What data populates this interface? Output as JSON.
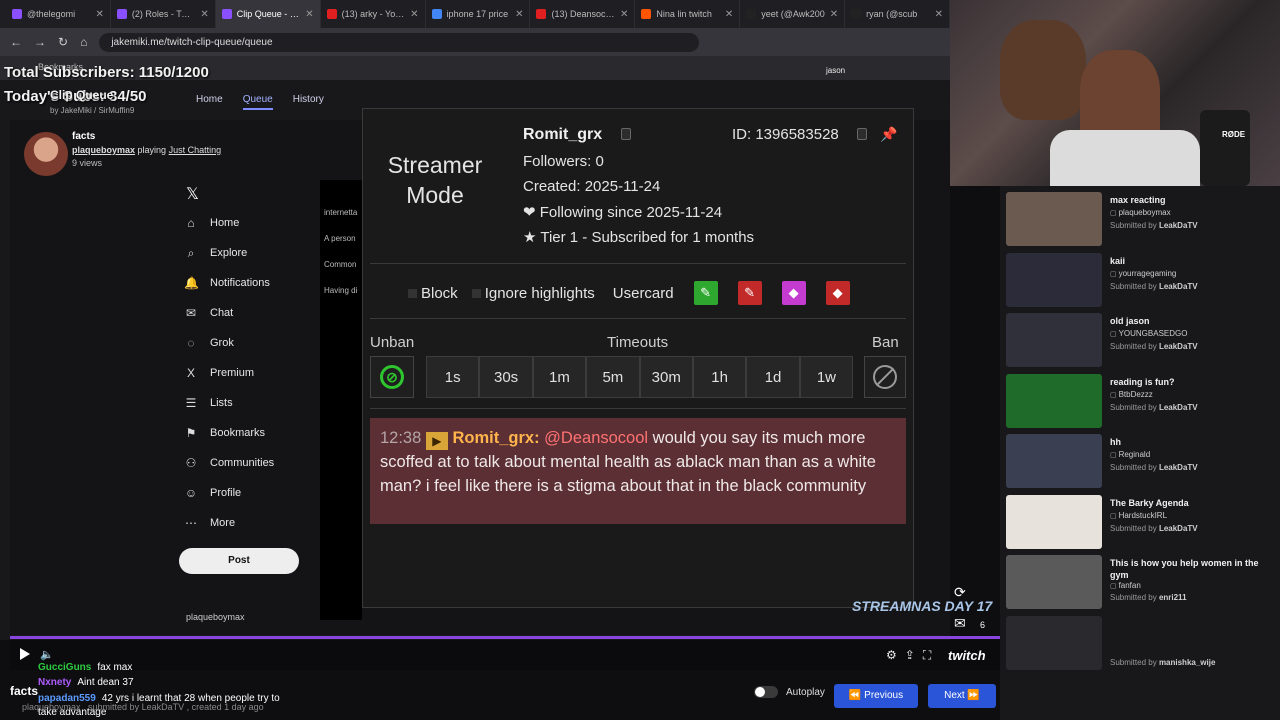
{
  "tabs": [
    {
      "label": "@thelegomi",
      "color": "#8a4fff"
    },
    {
      "label": "(2) Roles - Twitch",
      "color": "#8a4fff"
    },
    {
      "label": "Clip Queue - Cli",
      "color": "#8a4fff",
      "active": true
    },
    {
      "label": "(13) arky - YouTube",
      "color": "#e02020"
    },
    {
      "label": "iphone 17 price",
      "color": "#4285f4"
    },
    {
      "label": "(13) Deansocool",
      "color": "#e02020"
    },
    {
      "label": "Nina lin twitch",
      "color": "#ff5500"
    },
    {
      "label": "yeet (@Awk200",
      "color": "#222222"
    },
    {
      "label": "ryan (@scub",
      "color": "#222222"
    }
  ],
  "url": "jakemiki.me/twitch-clip-queue/queue",
  "bookmarks_label": "Bookmarks",
  "overlay": {
    "total_subs": "Total Subscribers: 1150/1200",
    "today_subs": "Today's Subs: 34/50",
    "cam_name": "jason"
  },
  "clip_nav": {
    "app_title": "Clip Queue",
    "by_line": "by JakeMiki / SirMuffin9",
    "links": [
      "Home",
      "Queue",
      "History"
    ]
  },
  "current_clip": {
    "title": "facts",
    "channel": "plaqueboymax",
    "playing_label": "playing",
    "game": "Just Chatting",
    "views": "9 views"
  },
  "x_sidebar": {
    "items": [
      {
        "label": "Home",
        "icon": "⌂"
      },
      {
        "label": "Explore",
        "icon": "⌕"
      },
      {
        "label": "Notifications",
        "icon": "🔔"
      },
      {
        "label": "Chat",
        "icon": "✉"
      },
      {
        "label": "Grok",
        "icon": "◌"
      },
      {
        "label": "Premium",
        "icon": "X"
      },
      {
        "label": "Lists",
        "icon": "☰"
      },
      {
        "label": "Bookmarks",
        "icon": "⚑"
      },
      {
        "label": "Communities",
        "icon": "⚇"
      },
      {
        "label": "Profile",
        "icon": "☺"
      },
      {
        "label": "More",
        "icon": "⋯"
      }
    ],
    "post": "Post",
    "profile_name": "plaqueboymax",
    "snippets": [
      "internetta",
      "A person",
      "Common",
      "Having di"
    ]
  },
  "usercard": {
    "mode": "Streamer Mode",
    "username": "Romit_grx",
    "id": "ID: 1396583528",
    "followers": "Followers: 0",
    "created": "Created: 2025-11-24",
    "following": "❤ Following since 2025-11-24",
    "tier": "★ Tier 1 - Subscribed for 1 months",
    "block": "Block",
    "ignore": "Ignore highlights",
    "usercard_label": "Usercard",
    "unban": "Unban",
    "timeouts_label": "Timeouts",
    "ban": "Ban",
    "timeouts": [
      "1s",
      "30s",
      "1m",
      "5m",
      "30m",
      "1h",
      "1d",
      "1w"
    ],
    "mod_buttons": [
      {
        "name": "mod-green-button",
        "color": "#2fa82f",
        "glyph": "✎"
      },
      {
        "name": "mod-red-button",
        "color": "#c22a2a",
        "glyph": "✎"
      },
      {
        "name": "vip-gem-button",
        "color": "#c43bd0",
        "glyph": "◆"
      },
      {
        "name": "vip-red-gem-button",
        "color": "#c22a2a",
        "glyph": "◆"
      }
    ],
    "message": {
      "time": "12:38",
      "author": "Romit_grx:",
      "mention": "@Deansocool",
      "text": "would you say its much more scoffed at to talk about mental health as ablack man than as a white man? i feel like there is a stigma about that in the black community"
    }
  },
  "chat_overlay": [
    {
      "user": "GucciGuns",
      "color": "#2ecc40",
      "text": "fax max"
    },
    {
      "user": "Nxnety",
      "color": "#b05cff",
      "text": "Aint dean 37"
    },
    {
      "user": "papadan559",
      "color": "#5b9bff",
      "text": "42 yrs i learnt that 28 when people try to take advantage"
    }
  ],
  "footer": {
    "clip_title": "facts",
    "submitted": "plaqueboymax , submitted by LeakDaTV , created 1 day ago",
    "autoplay": "Autoplay",
    "previous": "Previous",
    "next": "Next",
    "mail_count": "6",
    "streamnas": "STREAMNAS DAY 17"
  },
  "queue": [
    {
      "title": "max reacting",
      "channel": "plaqueboymax",
      "submitter": "LeakDaTV",
      "thumb": "#6a5a50"
    },
    {
      "title": "kaii",
      "channel": "yourragegaming",
      "submitter": "LeakDaTV",
      "thumb": "#2b2b3a"
    },
    {
      "title": "old jason",
      "channel": "YOUNGBASEDGO",
      "submitter": "LeakDaTV",
      "thumb": "#30303a"
    },
    {
      "title": "reading is fun?",
      "channel": "BtbDezzz",
      "submitter": "LeakDaTV",
      "thumb": "#1f6b2a"
    },
    {
      "title": "hh",
      "channel": "Reginald",
      "submitter": "LeakDaTV",
      "thumb": "#3b3f52"
    },
    {
      "title": "The Barky Agenda",
      "channel": "HardstuckIRL",
      "submitter": "LeakDaTV",
      "thumb": "#e8e2dc"
    },
    {
      "title": "This is how you help women in the gym",
      "channel": "fanfan",
      "submitter": "enri211",
      "thumb": "#5a5a5a"
    },
    {
      "title": "",
      "channel": "",
      "submitter": "manishka_wije",
      "thumb": "#2a2a2e"
    }
  ],
  "submitted_by_label": "Submitted by"
}
